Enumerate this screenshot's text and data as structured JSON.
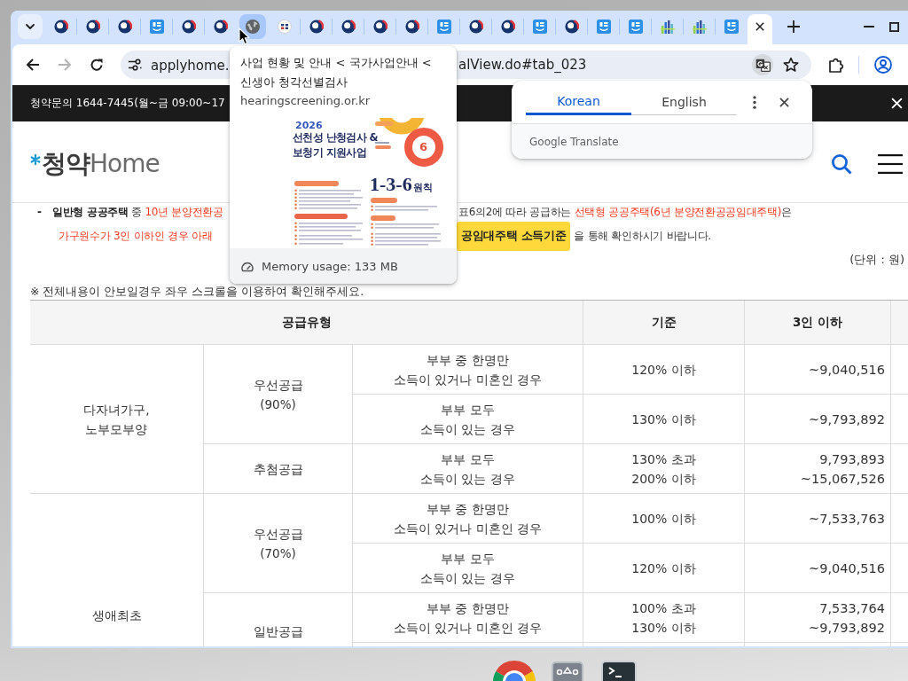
{
  "browser": {
    "tabs": [
      {
        "kind": "emblem",
        "selected": false,
        "hovered": false
      },
      {
        "kind": "emblem",
        "selected": false,
        "hovered": false
      },
      {
        "kind": "emblem",
        "selected": false,
        "hovered": false
      },
      {
        "kind": "app",
        "selected": false,
        "hovered": false
      },
      {
        "kind": "emblem",
        "selected": false,
        "hovered": false
      },
      {
        "kind": "emblem",
        "selected": false,
        "hovered": false
      },
      {
        "kind": "globe",
        "selected": false,
        "hovered": true
      },
      {
        "kind": "badge",
        "selected": false,
        "hovered": false
      },
      {
        "kind": "emblem",
        "selected": false,
        "hovered": false
      },
      {
        "kind": "emblem",
        "selected": false,
        "hovered": false
      },
      {
        "kind": "emblem",
        "selected": false,
        "hovered": false
      },
      {
        "kind": "emblem",
        "selected": false,
        "hovered": false
      },
      {
        "kind": "app",
        "selected": false,
        "hovered": false
      },
      {
        "kind": "emblem",
        "selected": false,
        "hovered": false
      },
      {
        "kind": "emblem",
        "selected": false,
        "hovered": false
      },
      {
        "kind": "app",
        "selected": false,
        "hovered": false
      },
      {
        "kind": "emblem",
        "selected": false,
        "hovered": false
      },
      {
        "kind": "app",
        "selected": false,
        "hovered": false
      },
      {
        "kind": "app",
        "selected": false,
        "hovered": false
      },
      {
        "kind": "towers",
        "selected": false,
        "hovered": false
      },
      {
        "kind": "towers",
        "selected": false,
        "hovered": false
      },
      {
        "kind": "app",
        "selected": false,
        "hovered": false
      },
      {
        "selected": true,
        "hovered": false
      }
    ],
    "nav_buttons": [
      {
        "kind": "back",
        "disabled": false
      },
      {
        "kind": "forward",
        "disabled": true
      },
      {
        "kind": "reload",
        "disabled": false
      }
    ],
    "address_bar": {
      "url_start": "applyhome.",
      "url_end": "alView.do#tab_023"
    },
    "hover_card": {
      "title": "사업 현황 및 안내 < 국가사업안내 < 신생아 청각선별검사",
      "domain": "hearingscreening.or.kr",
      "preview": {
        "year": "2026",
        "headline": [
          "선천성 난청검사 &",
          "보청기 지원사업"
        ],
        "ring_number": "6",
        "rule": "1-3-6",
        "rule_suffix": "원칙"
      },
      "memory": "Memory usage: 133 MB"
    },
    "translate_popup": {
      "languages": [
        {
          "label": "Korean",
          "selected": true
        },
        {
          "label": "English",
          "selected": false
        }
      ],
      "footer": "Google Translate"
    }
  },
  "page": {
    "notice": "청약문의 1644-7445(월~금 09:00~17",
    "logo": [
      "청약",
      "Home"
    ],
    "intro": {
      "marker": "-",
      "lines": [
        {
          "left": [
            {
              "text": "일반형 공공주택",
              "kind": "term"
            },
            {
              "text": " 중 ",
              "kind": "text"
            },
            {
              "text": "10년 분양전환공",
              "kind": "emphasis"
            }
          ],
          "right": [
            {
              "text": "표6의2에 따라 공급하는 ",
              "kind": "text"
            },
            {
              "text": "선택형 공공주택(6년 분양전환공공임대주택)",
              "kind": "emphasis"
            },
            {
              "text": "은",
              "kind": "text"
            }
          ]
        },
        {
          "left": [
            {
              "text": "가구원수가 3인 이하인 경우 아래",
              "kind": "emphasis"
            }
          ],
          "button": "공임대주택 소득기준",
          "right": [
            {
              "text": "을 통해 확인하시기 바랍니다.",
              "kind": "text"
            }
          ]
        }
      ]
    },
    "unit_note": "(단위 : 원)",
    "scroll_note": "※ 전체내용이 안보일경우 좌우 스크롤을 이용하여 확인해주세요.",
    "table": {
      "columns": [
        {
          "label": "공급유형"
        },
        {
          "label": "기준"
        },
        {
          "label": "3인 이하"
        }
      ],
      "groups": [
        {
          "label": [
            "다자녀가구,",
            "노부모부양"
          ],
          "supplies": [
            {
              "label": [
                "우선공급",
                "(90%)"
              ],
              "rows": [
                {
                  "condition": [
                    "부부 중 한명만",
                    "소득이 있거나 미혼인 경우"
                  ],
                  "criterion": [
                    "120% 이하"
                  ],
                  "amount": [
                    "~9,040,516"
                  ]
                },
                {
                  "condition": [
                    "부부 모두",
                    "소득이 있는 경우"
                  ],
                  "criterion": [
                    "130% 이하"
                  ],
                  "amount": [
                    "~9,793,892"
                  ]
                }
              ]
            },
            {
              "label": [
                "추첨공급"
              ],
              "rows": [
                {
                  "condition": [
                    "부부 모두",
                    "소득이 있는 경우"
                  ],
                  "criterion": [
                    "130% 초과",
                    "200% 이하"
                  ],
                  "amount": [
                    "9,793,893",
                    "~15,067,526"
                  ]
                }
              ]
            }
          ]
        },
        {
          "label": [
            "생애최초"
          ],
          "supplies": [
            {
              "label": [
                "우선공급",
                "(70%)"
              ],
              "rows": [
                {
                  "condition": [
                    "부부 중 한명만",
                    "소득이 있거나 미혼인 경우"
                  ],
                  "criterion": [
                    "100% 이하"
                  ],
                  "amount": [
                    "~7,533,763"
                  ]
                },
                {
                  "condition": [
                    "부부 모두",
                    "소득이 있는 경우"
                  ],
                  "criterion": [
                    "120% 이하"
                  ],
                  "amount": [
                    "~9,040,516"
                  ]
                }
              ]
            },
            {
              "label": [
                "일반공급"
              ],
              "rows": [
                {
                  "condition": [
                    "부부 중 한명만",
                    "소득이 있거나 미혼인 경우"
                  ],
                  "criterion": [
                    "100% 초과",
                    "130% 이하"
                  ],
                  "amount": [
                    "7,533,764",
                    "~9,793,892"
                  ]
                }
              ]
            }
          ]
        }
      ]
    }
  }
}
